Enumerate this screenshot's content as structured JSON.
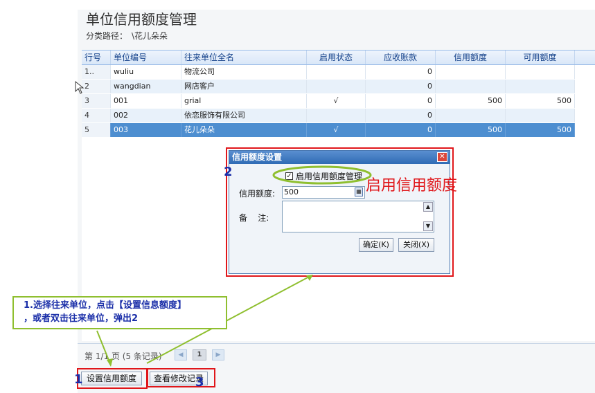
{
  "page": {
    "title": "单位信用额度管理",
    "breadcrumb_label": "分类路径：",
    "breadcrumb_path": "\\花儿朵朵"
  },
  "grid": {
    "columns": [
      "行号",
      "单位编号",
      "往来单位全名",
      "启用状态",
      "应收账款",
      "信用额度",
      "可用额度"
    ],
    "rows": [
      {
        "no": "1..",
        "code": "wuliu",
        "name": "物流公司",
        "status": "",
        "receivable": "0",
        "credit": "",
        "available": ""
      },
      {
        "no": "2",
        "code": "wangdian",
        "name": "网店客户",
        "status": "",
        "receivable": "0",
        "credit": "",
        "available": ""
      },
      {
        "no": "3",
        "code": "001",
        "name": "grial",
        "status": "√",
        "receivable": "0",
        "credit": "500",
        "available": "500"
      },
      {
        "no": "4",
        "code": "002",
        "name": "依恋服饰有限公司",
        "status": "",
        "receivable": "0",
        "credit": "",
        "available": ""
      },
      {
        "no": "5",
        "code": "003",
        "name": "花儿朵朵",
        "status": "√",
        "receivable": "0",
        "credit": "500",
        "available": "500"
      }
    ],
    "selected_row": 5
  },
  "pager": {
    "text": "第 1/1 页 (5 条记录)",
    "current_page": "1",
    "prev_icon": "prev-page-icon",
    "next_icon": "next-page-icon"
  },
  "buttons": {
    "set_credit": "设置信用额度",
    "view_log": "查看修改记录"
  },
  "dialog": {
    "title": "信用额度设置",
    "enable_label": "启用信用额度管理",
    "enable_checked": true,
    "credit_label": "信用额度:",
    "credit_value": "500",
    "note_label": "备    注:",
    "note_value": "",
    "ok_label": "确定(K)",
    "close_label": "关闭(X)"
  },
  "annotations": {
    "highlight_text": "启用信用额度",
    "instruction_line1": "1.选择往来单位，点击【设置信息额度】",
    "instruction_line2": "，或者双击往来单位，弹出2",
    "marker1": "1",
    "marker2": "2",
    "marker3": "3"
  },
  "colors": {
    "accent_red": "#e0161a",
    "annotation_green": "#8fbf2f",
    "annotation_blue": "#1a2ea8",
    "selected_row": "#4d8ed0"
  }
}
